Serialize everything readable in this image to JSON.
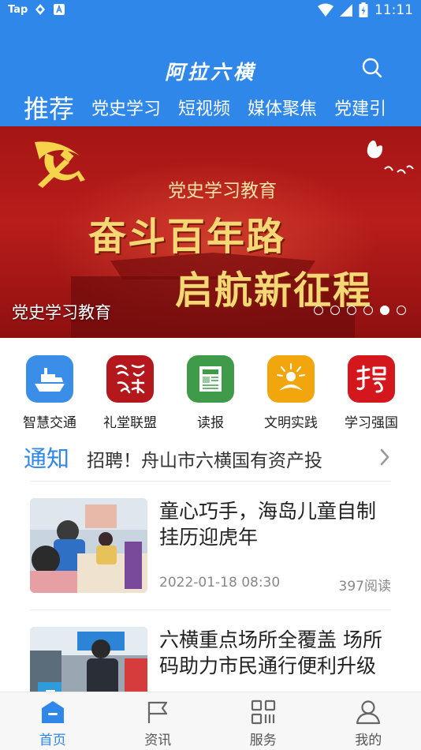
{
  "status_bar": {
    "time": "11:11",
    "left_label": "Tap"
  },
  "header": {
    "app_title": "阿拉六横",
    "search_icon": "search-icon",
    "tabs": [
      {
        "label": "推荐",
        "active": true
      },
      {
        "label": "党史学习",
        "active": false
      },
      {
        "label": "短视频",
        "active": false
      },
      {
        "label": "媒体聚焦",
        "active": false
      },
      {
        "label": "党建引",
        "active": false
      }
    ]
  },
  "banner": {
    "subtitle": "党史学习教育",
    "headline_1": "奋斗百年路",
    "headline_2": "启航新征程",
    "caption": "党史学习教育",
    "slide_count": 6,
    "active_slide": 5
  },
  "shortcuts": [
    {
      "label": "智慧交通",
      "icon": "ship-icon",
      "color": "#3a8ee8"
    },
    {
      "label": "礼堂联盟",
      "icon": "culture-hall-icon",
      "color": "#b5181c"
    },
    {
      "label": "读报",
      "icon": "newspaper-icon",
      "color": "#3f9b4a"
    },
    {
      "label": "文明实践",
      "icon": "civilization-practice-icon",
      "color": "#f2a60e"
    },
    {
      "label": "学习强国",
      "icon": "xuexi-icon",
      "color": "#d4161d"
    }
  ],
  "notice": {
    "tag": "通知",
    "text": "招聘！舟山市六横国有资产投"
  },
  "news": [
    {
      "title": "童心巧手，海岛儿童自制挂历迎虎年",
      "date": "2022-01-18 08:30",
      "reads": "397阅读"
    },
    {
      "title": "六横重点场所全覆盖 场所码助力市民通行便利升级",
      "date": "",
      "reads": ""
    }
  ],
  "bottom_nav": [
    {
      "label": "首页",
      "icon": "home-icon",
      "active": true
    },
    {
      "label": "资讯",
      "icon": "flag-icon",
      "active": false
    },
    {
      "label": "服务",
      "icon": "grid-icon",
      "active": false
    },
    {
      "label": "我的",
      "icon": "user-icon",
      "active": false
    }
  ],
  "colors": {
    "brand": "#2f87e9",
    "banner_red": "#b81d1b",
    "banner_gold": "#f6d776"
  }
}
